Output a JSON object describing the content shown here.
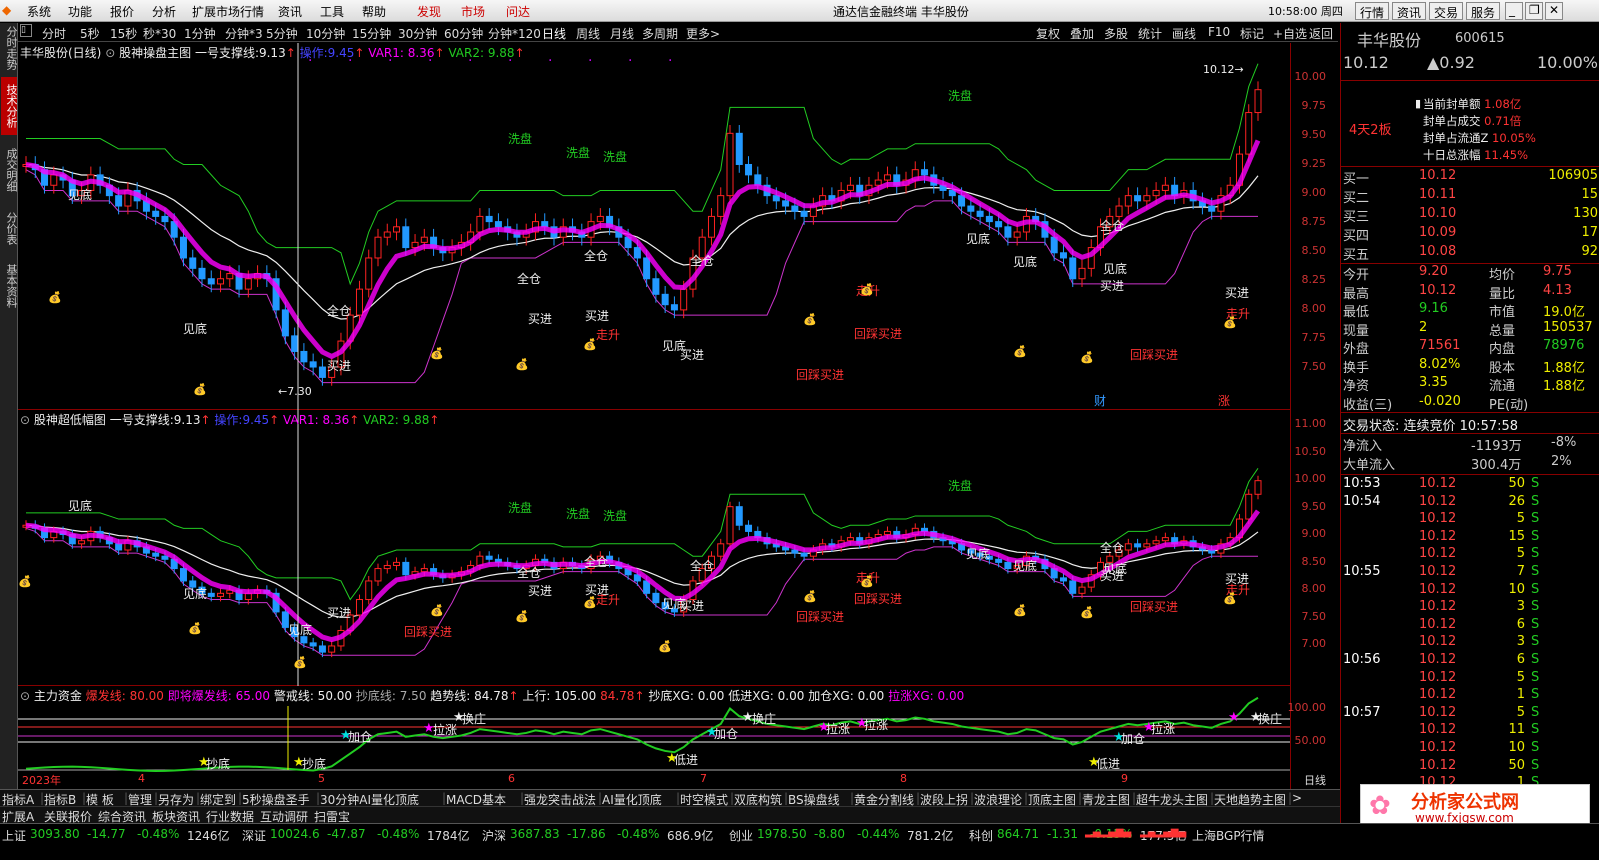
{
  "menu": {
    "items": [
      "系统",
      "功能",
      "报价",
      "分析",
      "扩展市场行情",
      "资讯",
      "工具",
      "帮助"
    ],
    "hot_items": [
      "发现",
      "市场",
      "问达"
    ],
    "title": "通达信金融终端 丰华股份",
    "clock": "10:58:00 周四",
    "right_buttons": [
      "行情",
      "资讯",
      "交易",
      "服务"
    ]
  },
  "periods": [
    "分时",
    "5秒",
    "15秒",
    "秒*30",
    "1分钟",
    "分钟*3",
    "5分钟",
    "10分钟",
    "15分钟",
    "30分钟",
    "60分钟",
    "分钟*120",
    "日线",
    "周线",
    "月线",
    "多周期",
    "更多>"
  ],
  "period_tools": [
    "复权",
    "叠加",
    "多股",
    "统计",
    "画线",
    "F10",
    "标记",
    "+自选",
    "返回"
  ],
  "left_tabs": [
    "分时走势",
    "技术分析",
    "成交明细",
    "分价表",
    "基本资料"
  ],
  "panel1": {
    "title": "丰华股份(日线)",
    "formula": "股神操盘主图",
    "support_label": "一号支撑线:",
    "support": "9.13",
    "op_label": "操作:",
    "op": "9.45",
    "var1": "VAR1: 8.36",
    "var2": "VAR2: 9.88",
    "last_price": "10.12",
    "low_label": "7.30",
    "axis": [
      "10.00",
      "9.75",
      "9.50",
      "9.25",
      "9.00",
      "8.75",
      "8.50",
      "8.25",
      "8.00",
      "7.75",
      "7.50"
    ]
  },
  "panel2": {
    "formula": "股神超低幅图",
    "support_label": "一号支撑线:",
    "support": "9.13",
    "op_label": "操作:",
    "op": "9.45",
    "var1": "VAR1: 8.36",
    "var2": "VAR2: 9.88",
    "axis": [
      "11.00",
      "10.50",
      "10.00",
      "9.50",
      "9.00",
      "8.50",
      "8.00",
      "7.50",
      "7.00"
    ]
  },
  "panel3": {
    "formula": "主力资金",
    "burst": "爆发线: 80.00",
    "near_burst": "即将爆发线: 65.00",
    "alert": "警戒线: 50.00",
    "bottom_line": "抄底线: 7.50",
    "trend": "趋势线: 84.78",
    "up": "上行: 105.00",
    "up_val": "84.78",
    "xg1": "抄底XG: 0.00",
    "xg2": "低进XG: 0.00",
    "xg3": "加仓XG: 0.00",
    "xg4": "拉涨XG: 0.00",
    "axis": [
      "100.00",
      "50.00"
    ],
    "dates": [
      "2023年",
      "4",
      "5",
      "6",
      "7",
      "8",
      "9"
    ],
    "period": "日线"
  },
  "chart_labels": {
    "jiandi": "见底",
    "xipan": "洗盘",
    "quancang": "全仓",
    "maijin": "买进",
    "zousheng": "走升",
    "huicai": "回踩买进",
    "huanzhuang": "换庄",
    "jiacang": "加仓",
    "lazhang": "拉涨",
    "dijin": "低进",
    "chaodi": "抄底",
    "caifu": "财",
    "zhang": "涨"
  },
  "quote": {
    "name": "丰华股份",
    "code": "600615",
    "price": "10.12",
    "change": "▲0.92",
    "pct": "10.00%",
    "board": "4天2板",
    "seal_amount_label": "当前封单额",
    "seal_amount": "1.08亿",
    "seal_vol_label": "封单占成交",
    "seal_vol": "0.71倍",
    "seal_float_label": "封单占流通Z",
    "seal_float": "10.05%",
    "ten_day_label": "十日总涨幅",
    "ten_day": "11.45%",
    "bids": [
      {
        "label": "买一",
        "price": "10.12",
        "vol": "106905"
      },
      {
        "label": "买二",
        "price": "10.11",
        "vol": "15"
      },
      {
        "label": "买三",
        "price": "10.10",
        "vol": "130"
      },
      {
        "label": "买四",
        "price": "10.09",
        "vol": "17"
      },
      {
        "label": "买五",
        "price": "10.08",
        "vol": "92"
      }
    ],
    "stats": [
      {
        "l": "今开",
        "v": "9.20",
        "l2": "均价",
        "v2": "9.75"
      },
      {
        "l": "最高",
        "v": "10.12",
        "l2": "量比",
        "v2": "4.13"
      },
      {
        "l": "最低",
        "v": "9.16",
        "l2": "市值",
        "v2": "19.0亿"
      },
      {
        "l": "现量",
        "v": "2",
        "l2": "总量",
        "v2": "150537"
      },
      {
        "l": "外盘",
        "v": "71561",
        "l2": "内盘",
        "v2": "78976"
      },
      {
        "l": "换手",
        "v": "8.02%",
        "l2": "股本",
        "v2": "1.88亿"
      },
      {
        "l": "净资",
        "v": "3.35",
        "l2": "流通",
        "v2": "1.88亿"
      },
      {
        "l": "收益(三)",
        "v": "-0.020",
        "l2": "PE(动)",
        "v2": ""
      }
    ],
    "trade_state": "交易状态: 连续竞价 10:57:58",
    "net_in_label": "净流入",
    "net_in": "-1193万",
    "net_in_pct": "-8%",
    "big_in_label": "大单流入",
    "big_in": "300.4万",
    "big_in_pct": "2%",
    "ticks": [
      {
        "t": "10:53",
        "p": "10.12",
        "v": "50",
        "s": "S"
      },
      {
        "t": "10:54",
        "p": "10.12",
        "v": "26",
        "s": "S"
      },
      {
        "t": "",
        "p": "10.12",
        "v": "5",
        "s": "S"
      },
      {
        "t": "",
        "p": "10.12",
        "v": "15",
        "s": "S"
      },
      {
        "t": "",
        "p": "10.12",
        "v": "5",
        "s": "S"
      },
      {
        "t": "10:55",
        "p": "10.12",
        "v": "7",
        "s": "S"
      },
      {
        "t": "",
        "p": "10.12",
        "v": "10",
        "s": "S"
      },
      {
        "t": "",
        "p": "10.12",
        "v": "3",
        "s": "S"
      },
      {
        "t": "",
        "p": "10.12",
        "v": "6",
        "s": "S"
      },
      {
        "t": "",
        "p": "10.12",
        "v": "3",
        "s": "S"
      },
      {
        "t": "10:56",
        "p": "10.12",
        "v": "6",
        "s": "S"
      },
      {
        "t": "",
        "p": "10.12",
        "v": "5",
        "s": "S"
      },
      {
        "t": "",
        "p": "10.12",
        "v": "1",
        "s": "S"
      },
      {
        "t": "10:57",
        "p": "10.12",
        "v": "5",
        "s": "S"
      },
      {
        "t": "",
        "p": "10.12",
        "v": "11",
        "s": "S"
      },
      {
        "t": "",
        "p": "10.12",
        "v": "10",
        "s": "S"
      },
      {
        "t": "",
        "p": "10.12",
        "v": "50",
        "s": "S"
      },
      {
        "t": "",
        "p": "10.12",
        "v": "1",
        "s": "S"
      }
    ]
  },
  "bottom_tabs": [
    "指标A",
    "指标B",
    "模 板",
    "管理",
    "另存为",
    "绑定到",
    "5秒操盘圣手",
    "30分钟AI量化顶底",
    "MACD基本",
    "强龙突击战法",
    "AI量化顶底",
    "时空模式",
    "双底构筑",
    "BS操盘线",
    "黄金分割线",
    "波段上拐",
    "波浪理论",
    "顶底主图",
    "青龙主图",
    "超牛龙头主图",
    "天地趋势主图",
    ">"
  ],
  "bottom_tabs2": [
    "扩展A",
    "关联报价",
    "综合资讯",
    "板块资讯",
    "行业数据",
    "互动调研",
    "扫雷宝"
  ],
  "status": [
    {
      "n": "上证",
      "p": "3093.80",
      "c": "-14.77",
      "pc": "-0.48%",
      "a": "1246亿"
    },
    {
      "n": "深证",
      "p": "10024.6",
      "c": "-47.87",
      "pc": "-0.48%",
      "a": "1784亿"
    },
    {
      "n": "沪深",
      "p": "3687.83",
      "c": "-17.86",
      "pc": "-0.48%",
      "a": "686.9亿"
    },
    {
      "n": "创业",
      "p": "1978.50",
      "c": "-8.80",
      "pc": "-0.44%",
      "a": "781.2亿"
    },
    {
      "n": "科创",
      "p": "864.71",
      "c": "-1.31",
      "pc": "-0.15%",
      "a": "177.5亿"
    }
  ],
  "status_right": "上海BGP行情",
  "logo_text": "分析家公式网",
  "logo_url": "www.fxjgsw.com",
  "colors": {
    "up": "#ff3333",
    "down": "#00ccff",
    "magenta": "#ff00ff",
    "green": "#22cc22",
    "white": "#eeeeee"
  }
}
